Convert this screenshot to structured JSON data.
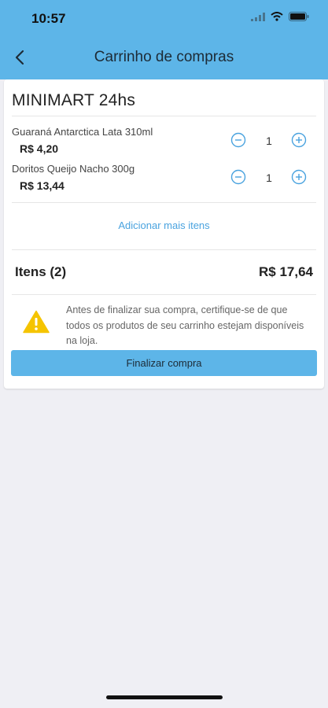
{
  "status_bar": {
    "time": "10:57"
  },
  "header": {
    "title": "Carrinho de compras"
  },
  "store": {
    "name": "MINIMART 24hs"
  },
  "cart_items": [
    {
      "name": "Guaraná Antarctica Lata 310ml",
      "price": "R$ 4,20",
      "quantity": "1"
    },
    {
      "name": "Doritos Queijo Nacho 300g",
      "price": "R$ 13,44",
      "quantity": "1"
    }
  ],
  "add_more_label": "Adicionar mais itens",
  "summary": {
    "items_label": "Itens (2)",
    "total": "R$ 17,64"
  },
  "warning": {
    "text": "Antes de finalizar sua compra, certifique-se de que todos os produtos de seu carrinho estejam disponíveis na loja."
  },
  "finish_button": {
    "label": "Finalizar compra"
  },
  "colors": {
    "primary": "#5db5e8",
    "link": "#4aa3df",
    "warning": "#f5c400"
  },
  "icons": [
    "signal-icon",
    "wifi-icon",
    "battery-icon",
    "back-arrow-icon",
    "minus-circle-icon",
    "plus-circle-icon",
    "warning-icon"
  ]
}
